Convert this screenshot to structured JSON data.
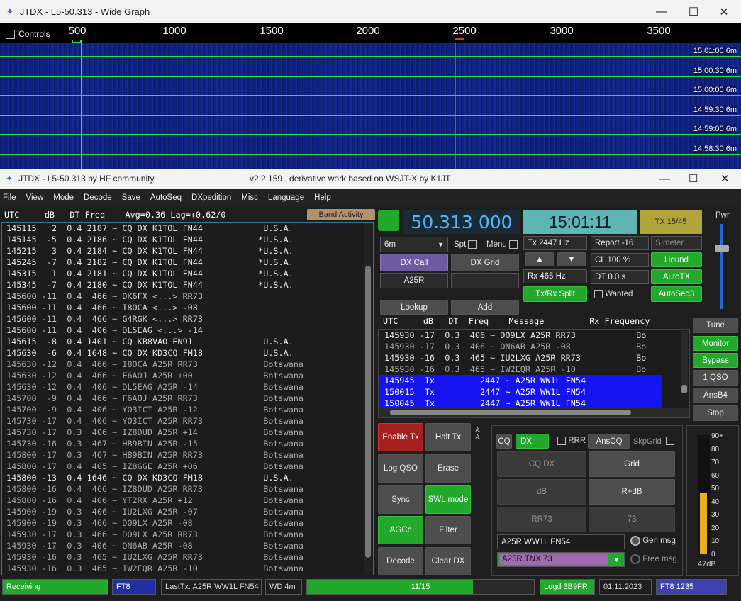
{
  "wide": {
    "title": "JTDX - L5-50.313 - Wide Graph",
    "controls": "Controls",
    "ticks": [
      "500",
      "1000",
      "1500",
      "2000",
      "2500",
      "3000",
      "3500"
    ],
    "times": [
      "15:01:00  6m",
      "15:00:30  6m",
      "15:00:00  6m",
      "14:59:30  6m",
      "14:59:00  6m",
      "14:58:30  6m"
    ]
  },
  "main": {
    "title": "JTDX - L5-50.313  by HF community",
    "subtitle": "v2.2.159 , derivative work based on WSJT-X by K1JT",
    "menu": [
      "File",
      "View",
      "Mode",
      "Decode",
      "Save",
      "AutoSeq",
      "DXpedition",
      "Misc",
      "Language",
      "Help"
    ]
  },
  "left": {
    "header": "UTC     dB   DT Freq    Avg=0.36 Lag=+0.62/0",
    "band_activity": "Band Activity",
    "rows": [
      "145115   2  0.4 2187 ~ CQ DX K1TOL FN44            U.S.A.",
      "145145  -5  0.4 2186 ~ CQ DX K1TOL FN44           *U.S.A.",
      "145215   3  0.4 2184 ~ CQ DX K1TOL FN44           *U.S.A.",
      "145245  -7  0.4 2182 ~ CQ DX K1TOL FN44           *U.S.A.",
      "145315   1  0.4 2181 ~ CQ DX K1TOL FN44           *U.S.A.",
      "145345  -7  0.4 2180 ~ CQ DX K1TOL FN44           *U.S.A.",
      "145600 -11  0.4  466 ~ DK6FX <...> RR73",
      "145600 -11  0.4  466 ~ I8OCA <...> -08",
      "145600 -11  0.4  466 ~ G4RGK <...> RR73",
      "145600 -11  0.4  406 ~ DL5EAG <...> -14",
      "145615  -8  0.4 1401 ~ CQ KB8VAO EN91              U.S.A.",
      "145630  -6  0.4 1648 ~ CQ DX KD3CQ FM18            U.S.A.",
      "145630 -12  0.4  466 ~ I8OCA A25R RR73             Botswana",
      "145630 -12  0.4  466 ~ F6AOJ A25R +00              Botswana",
      "145630 -12  0.4  406 ~ DL5EAG A25R -14             Botswana",
      "145700  -9  0.4  466 ~ F6AOJ A25R RR73             Botswana",
      "145700  -9  0.4  406 ~ YO3ICT A25R -12             Botswana",
      "145730 -17  0.4  406 ~ YO3ICT A25R RR73            Botswana",
      "145730 -17  0.3  406 ~ IZ8DUD A25R +14             Botswana",
      "145730 -16  0.3  467 ~ HB9BIN A25R -15             Botswana",
      "145800 -17  0.3  467 ~ HB9BIN A25R RR73            Botswana",
      "145800 -17  0.4  405 ~ IZ8GGE A25R +06             Botswana",
      "145800 -13  0.4 1646 ~ CQ DX KD3CQ FM18            U.S.A.",
      "145800 -16  0.4  466 ~ IZ8DUD A25R RR73            Botswana",
      "145800 -16  0.4  406 ~ YT2RX A25R +12              Botswana",
      "145900 -19  0.3  406 ~ IU2LXG A25R -07             Botswana",
      "145900 -19  0.3  466 ~ DO9LX A25R -08              Botswana",
      "145930 -17  0.3  466 ~ DO9LX A25R RR73             Botswana",
      "145930 -17  0.3  406 ~ ON6AB A25R -08              Botswana",
      "145930 -16  0.3  465 ~ IU2LXG A25R RR73            Botswana",
      "145930 -16  0.3  465 ~ IW2EQR A25R -10             Botswana"
    ]
  },
  "top": {
    "freq": "50.313 000",
    "clock": "15:01:11",
    "tx_period": "TX 15/45",
    "pwr": "Pwr",
    "band": "6m",
    "spt": "Spt",
    "menu": "Menu",
    "tx_hz": "Tx  2447 Hz",
    "rx_hz": "Rx  465 Hz",
    "report": "Report -16",
    "smeter": "S meter",
    "cl": "CL  100 %",
    "dt": "DT 0.0 s",
    "dx_call_btn": "DX Call",
    "dx_grid_btn": "DX Grid",
    "dx_call_val": "A25R",
    "dx_grid_val": "",
    "hound": "Hound",
    "autotx": "AutoTX",
    "split": "Tx/Rx Split",
    "wanted": "Wanted",
    "autoseq3": "AutoSeq3",
    "lookup": "Lookup",
    "add": "Add"
  },
  "rx": {
    "header": "UTC     dB   DT  Freq    Message         Rx Frequency",
    "rows": [
      {
        "t": "145930 -17  0.3  406 ~ DO9LX A25R RR73            Bo",
        "hl": false
      },
      {
        "t": "145930 -17  0.3  406 ~ ON6AB A25R -08             Bo",
        "hl": false
      },
      {
        "t": "145930 -16  0.3  465 ~ IU2LXG A25R RR73           Bo",
        "hl": false
      },
      {
        "t": "145930 -16  0.3  465 ~ IW2EQR A25R -10            Bo",
        "hl": false
      },
      {
        "t": "145945  Tx         2447 ~ A25R WW1L FN54",
        "hl": true
      },
      {
        "t": "150015  Tx         2447 ~ A25R WW1L FN54",
        "hl": true
      },
      {
        "t": "150045  Tx         2447 ~ A25R WW1L FN54",
        "hl": true
      }
    ]
  },
  "side": {
    "tune": "Tune",
    "monitor": "Monitor",
    "bypass": "Bypass",
    "qso1": "1 QSO",
    "ansb4": "AnsB4",
    "stop": "Stop"
  },
  "ctl": {
    "enable_tx": "Enable Tx",
    "halt_tx": "Halt Tx",
    "log_qso": "Log QSO",
    "erase": "Erase",
    "sync": "Sync",
    "swl": "SWL mode",
    "agcc": "AGCc",
    "filter": "Filter",
    "decode": "Decode",
    "clear_dx": "Clear DX"
  },
  "msg": {
    "cq": "CQ",
    "dx": "DX",
    "rrr": "RRR",
    "anscq": "AnsCQ",
    "skpgrid": "SkpGrid",
    "cqdx": "CQ DX",
    "grid": "Grid",
    "db": "dB",
    "rdb": "R+dB",
    "rr73": "RR73",
    "m73": "73",
    "gen_text": "A25R WW1L FN54",
    "sel_text": "A25R TNX 73",
    "gen_msg": "Gen msg",
    "free_msg": "Free msg"
  },
  "meter": {
    "ticks": [
      "90+",
      "80",
      "70",
      "60",
      "50",
      "40",
      "30",
      "20",
      "10",
      "0"
    ],
    "value": "47dB",
    "level": 0.47
  },
  "status": {
    "state": "Receiving",
    "mode": "FT8",
    "last_tx": "LastTx: A25R WW1L FN54",
    "wd": "WD 4m",
    "progress": "11/15",
    "progress_frac": 0.73,
    "logd": "Logd 3B9FR",
    "date": "01.11.2023",
    "mode2": "FT8  1235"
  },
  "colors": {
    "green": "#22a82a",
    "hl": "#1414f0",
    "freq": "#4fb6ff"
  }
}
